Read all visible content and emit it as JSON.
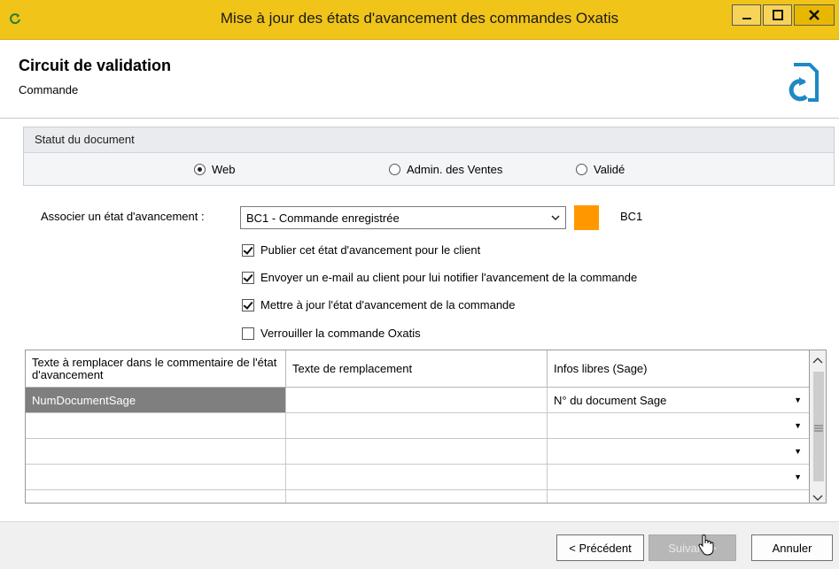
{
  "window": {
    "title": "Mise à jour des états d'avancement des commandes Oxatis",
    "title_bar_color": "#f0c419"
  },
  "header": {
    "title": "Circuit de validation",
    "subtitle": "Commande"
  },
  "status_group": {
    "title": "Statut du document",
    "options": [
      {
        "label": "Web",
        "selected": true
      },
      {
        "label": "Admin. des Ventes",
        "selected": false
      },
      {
        "label": "Validé",
        "selected": false
      }
    ]
  },
  "form": {
    "assoc_label": "Associer un état d'avancement :",
    "state_value": "BC1 - Commande enregistrée",
    "state_color": "#ff9800",
    "state_code": "BC1",
    "checkboxes": [
      {
        "label": "Publier cet état d'avancement pour le client",
        "checked": true
      },
      {
        "label": "Envoyer un e-mail au client pour lui notifier l'avancement de la commande",
        "checked": true
      },
      {
        "label": "Mettre à jour l'état d'avancement de la commande",
        "checked": true
      },
      {
        "label": "Verrouiller la commande Oxatis",
        "checked": false
      }
    ]
  },
  "grid": {
    "columns": [
      "Texte à remplacer dans le commentaire de l'état d'avancement",
      "Texte de remplacement",
      "Infos libres (Sage)"
    ],
    "rows": [
      {
        "c1": "NumDocumentSage",
        "c2": "",
        "c3": "N° du document Sage"
      },
      {
        "c1": "",
        "c2": "",
        "c3": ""
      },
      {
        "c1": "",
        "c2": "",
        "c3": ""
      },
      {
        "c1": "",
        "c2": "",
        "c3": ""
      }
    ]
  },
  "footer": {
    "prev_label": "< Précédent",
    "next_label": "Suivant >",
    "cancel_label": "Annuler"
  }
}
